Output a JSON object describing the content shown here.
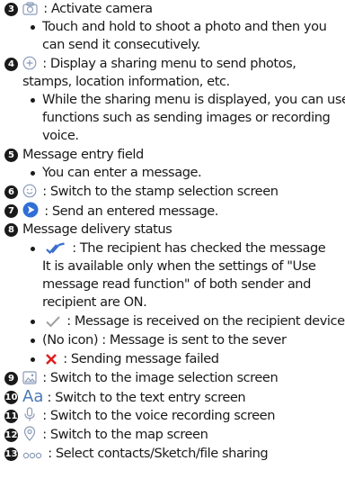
{
  "items": {
    "i3": {
      "num": "3",
      "text": " : Activate camera",
      "icon": "camera-icon"
    },
    "i3b1": {
      "line1": "Touch and hold to shoot a photo and then you",
      "line2": "can send it consecutively."
    },
    "i4": {
      "num": "4",
      "text": " : Display a sharing menu to send photos,",
      "line2": "stamps, location information, etc.",
      "icon": "plus-circle-icon"
    },
    "i4b1": {
      "line1": "While the sharing menu is displayed, you can use",
      "line2": "functions such as sending images or recording",
      "line3": "voice."
    },
    "i5": {
      "num": "5",
      "text": "Message entry field"
    },
    "i5b1": {
      "line1": "You can enter a message."
    },
    "i6": {
      "num": "6",
      "text": " : Switch to the stamp selection screen",
      "icon": "smiley-icon"
    },
    "i7": {
      "num": "7",
      "text": " : Send an entered message.",
      "icon": "send-icon"
    },
    "i8": {
      "num": "8",
      "text": "Message delivery status"
    },
    "i8b1": {
      "line1": " : The recipient has checked the message",
      "line2": "It is available only when the settings of \"Use",
      "line3": "message read function\" of both sender and",
      "line4": "recipient are ON.",
      "icon": "double-check-icon"
    },
    "i8b2": {
      "line1": " : Message is received on the recipient device",
      "icon": "check-icon"
    },
    "i8b3": {
      "line1": "(No icon) : Message is sent to the sever"
    },
    "i8b4": {
      "line1": " : Sending message failed",
      "icon": "x-mark-icon"
    },
    "i9": {
      "num": "9",
      "text": " : Switch to the image selection screen",
      "icon": "image-icon"
    },
    "i10": {
      "num": "10",
      "text": " : Switch to the text entry screen",
      "icon_text": "Aa"
    },
    "i11": {
      "num": "11",
      "text": " : Switch to the voice recording screen",
      "icon": "microphone-icon"
    },
    "i12": {
      "num": "12",
      "text": " : Switch to the map screen",
      "icon": "map-pin-icon"
    },
    "i13": {
      "num": "13",
      "text": " : Select contacts/Sketch/file sharing",
      "icon": "more-dots-icon"
    }
  },
  "colors": {
    "text": "#1a1a1a",
    "accent": "#4a78b8",
    "send": "#2f6fd6",
    "fail": "#e02020"
  }
}
